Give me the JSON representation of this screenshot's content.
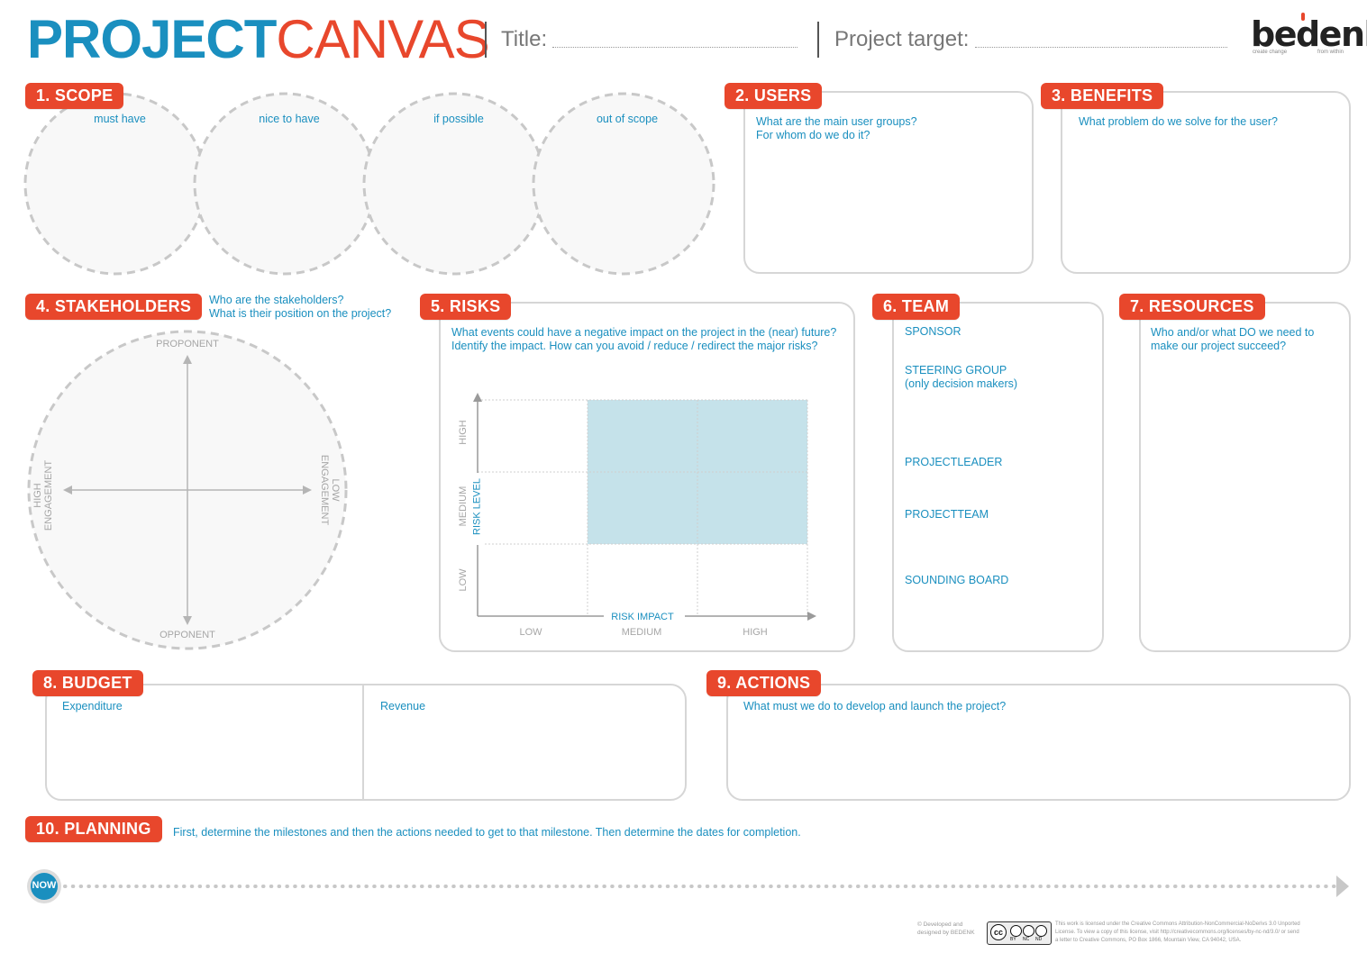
{
  "header": {
    "title_part1": "PROJECT",
    "title_part2": "CANVAS",
    "title_label": "Title:",
    "target_label": "Project target:",
    "logo_text": "bedenk",
    "logo_tagline_left": "create change",
    "logo_tagline_right": "from within"
  },
  "scope": {
    "tag": "1. SCOPE",
    "circles": [
      "must have",
      "nice to have",
      "if possible",
      "out of scope"
    ]
  },
  "users": {
    "tag": "2. USERS",
    "line1": "What are the main user groups?",
    "line2": "For whom do we do it?"
  },
  "benefits": {
    "tag": "3. BENEFITS",
    "line1": "What problem do we solve for the user?"
  },
  "stakeholders": {
    "tag": "4. STAKEHOLDERS",
    "line1": "Who are the stakeholders?",
    "line2": "What is their position on the project?",
    "top": "PROPONENT",
    "bottom": "OPPONENT",
    "left1": "HIGH",
    "left2": "ENGAGEMENT",
    "right1": "LOW",
    "right2": "ENGAGEMENT"
  },
  "risks": {
    "tag": "5. RISKS",
    "line1": "What events could have a negative impact on the project in the (near) future?",
    "line2": "Identify the impact. How can you avoid / reduce / redirect the major risks?",
    "y_high": "HIGH",
    "y_medium": "MEDIUM",
    "y_low": "LOW",
    "y_title": "RISK LEVEL",
    "x_title": "RISK IMPACT",
    "x_low": "LOW",
    "x_medium": "MEDIUM",
    "x_high": "HIGH",
    "highlight_color": "#c5e2ea"
  },
  "team": {
    "tag": "6. TEAM",
    "sponsor": "SPONSOR",
    "steering1": "STEERING GROUP",
    "steering2": "(only decision makers)",
    "leader": "PROJECTLEADER",
    "team": "PROJECTTEAM",
    "sounding": "SOUNDING BOARD"
  },
  "resources": {
    "tag": "7. RESOURCES",
    "line1": "Who and/or what DO we need to",
    "line2": "make our project succeed?"
  },
  "budget": {
    "tag": "8. BUDGET",
    "expenditure": "Expenditure",
    "revenue": "Revenue"
  },
  "actions": {
    "tag": "9. ACTIONS",
    "line1": "What must we do to develop and launch the project?"
  },
  "planning": {
    "tag": "10. PLANNING",
    "line1": "First, determine the milestones and then the actions needed to get to that milestone. Then determine the dates for completion.",
    "now": "NOW"
  },
  "footer": {
    "dev1": "© Developed and",
    "dev2": "designed by BEDENK",
    "cc_badge": "cc",
    "cc_by": "BY",
    "cc_nc": "NC",
    "cc_nd": "ND",
    "license1": "This work is licensed under the Creative Commons Attribution-NonCommercial-NoDerivs 3.0 Unported",
    "license2": "License. To view a copy of this license, visit http://creativecommons.org/licenses/by-nc-nd/3.0/ or send",
    "license3": "a letter to Creative Commons, PO Box 1866, Mountain View, CA 94042, USA."
  },
  "colors": {
    "accent_red": "#e8472c",
    "accent_blue": "#1a8fbf",
    "border_gray": "#d6d6d6"
  }
}
